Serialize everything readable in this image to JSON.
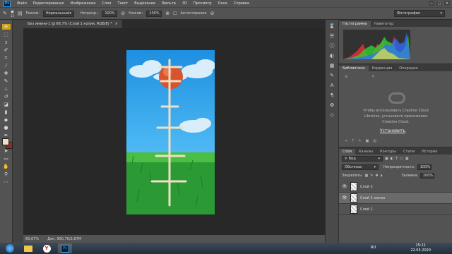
{
  "menubar": {
    "logo": "Ps",
    "items": [
      "Файл",
      "Редактирование",
      "Изображение",
      "Слои",
      "Текст",
      "Выделение",
      "Фильтр",
      "3D",
      "Просмотр",
      "Окно",
      "Справка"
    ],
    "win_min": "—",
    "win_max": "□",
    "win_close": "✕"
  },
  "options": {
    "brush_size": "13",
    "mode_label": "Режим:",
    "mode_value": "Нормальный",
    "opacity_label": "Непрозр.:",
    "opacity_value": "100%",
    "pressure_label": "Нажим:",
    "pressure_value": "100%",
    "autoerase_label": "Автостирание",
    "workspace": "Фотография"
  },
  "document": {
    "tab_title": "Без имени-1 @ 66,7% (Слой 1 копия, RGB/8) *",
    "tab_close": "×",
    "zoom": "66,67%",
    "doc_info": "Док: 900,7K/2,87M"
  },
  "panels": {
    "histogram_tabs": [
      "Гистограмма",
      "Навигатор"
    ],
    "adj_tabs": [
      "Библиотеки",
      "Коррекция",
      "Операции"
    ],
    "library_message": "Чтобы использовать Creative Cloud Libraries, установите приложение Creative Cloud.",
    "install_link": "Установить",
    "layers_tabs": [
      "Слои",
      "Каналы",
      "Контуры",
      "Стили",
      "История"
    ],
    "kind_label": "Вид",
    "blend_mode": "Обычные",
    "opacity_label": "Непрозрачность:",
    "opacity_value": "100%",
    "lock_label": "Закрепить:",
    "fill_label": "Заливка:",
    "fill_value": "100%",
    "layers": [
      {
        "name": "Слой 2",
        "visible": true,
        "selected": false
      },
      {
        "name": "Слой 1 копия",
        "visible": true,
        "selected": true
      },
      {
        "name": "Слой 1",
        "visible": false,
        "selected": false
      }
    ]
  },
  "taskbar": {
    "lang": "RU",
    "time": "15:11",
    "date": "22.05.2020",
    "apps": [
      "start-orb-icon",
      "explorer-icon",
      "yandex-browser-icon",
      "photoshop-icon"
    ]
  },
  "colors": {
    "foreground": "#f3dfc9",
    "background": "#8c2c20",
    "accent": "#2fa3f7"
  }
}
